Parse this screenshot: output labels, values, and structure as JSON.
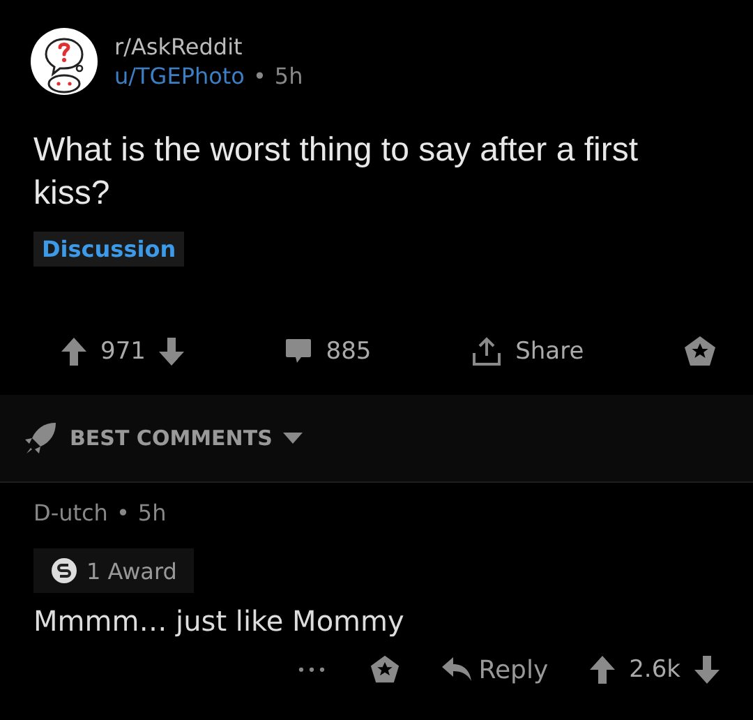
{
  "post": {
    "subreddit": "r/AskReddit",
    "author": "u/TGEPhoto",
    "separator": "•",
    "age": "5h",
    "title": "What is the worst thing to say after a first kiss?",
    "flair": "Discussion",
    "score": "971",
    "comments": "885",
    "share": "Share"
  },
  "sort": {
    "label": "BEST COMMENTS"
  },
  "comment": {
    "author": "D-utch",
    "separator": "•",
    "age": "5h",
    "award": "1 Award",
    "body": "Mmmm… just like Mommy",
    "more": "•••",
    "reply": "Reply",
    "score": "2.6k"
  }
}
